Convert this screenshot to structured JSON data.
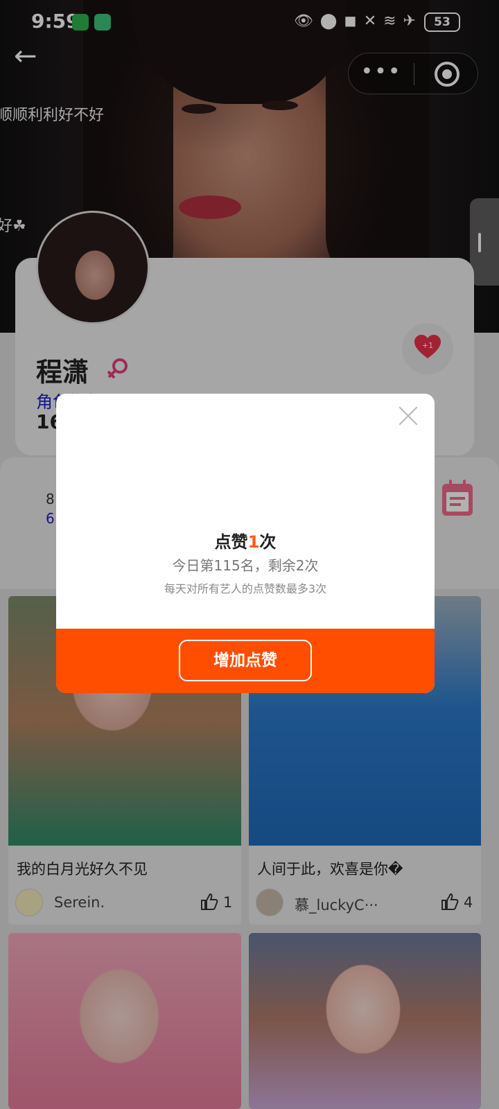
{
  "status_bar": {
    "time": "9:59",
    "battery": "53"
  },
  "hero": {
    "text_1": "顺顺利利好不好",
    "text_2": "好☘"
  },
  "capsule": {
    "more_label": "•••"
  },
  "profile": {
    "name": "程潇",
    "role_link": "角色指数",
    "fans_value": "16",
    "like_badge": "+1"
  },
  "stats": {
    "line_1": "8",
    "line_2": "6"
  },
  "posts": [
    {
      "title": "我的白月光好久不见",
      "author": "Serein.",
      "likes": "1"
    },
    {
      "title": "人间于此，欢喜是你�",
      "author": "慕_luckyC···",
      "likes": "4"
    }
  ],
  "dialog": {
    "title_prefix": "点赞",
    "title_count": "1",
    "title_suffix": "次",
    "subtitle": "今日第115名，剩余2次",
    "hint": "每天对所有艺人的点赞数最多3次",
    "button_label": "增加点赞"
  },
  "colors": {
    "accent": "#ff4e00",
    "count_highlight": "#ff5a14",
    "link_blue": "#1a1acc"
  }
}
